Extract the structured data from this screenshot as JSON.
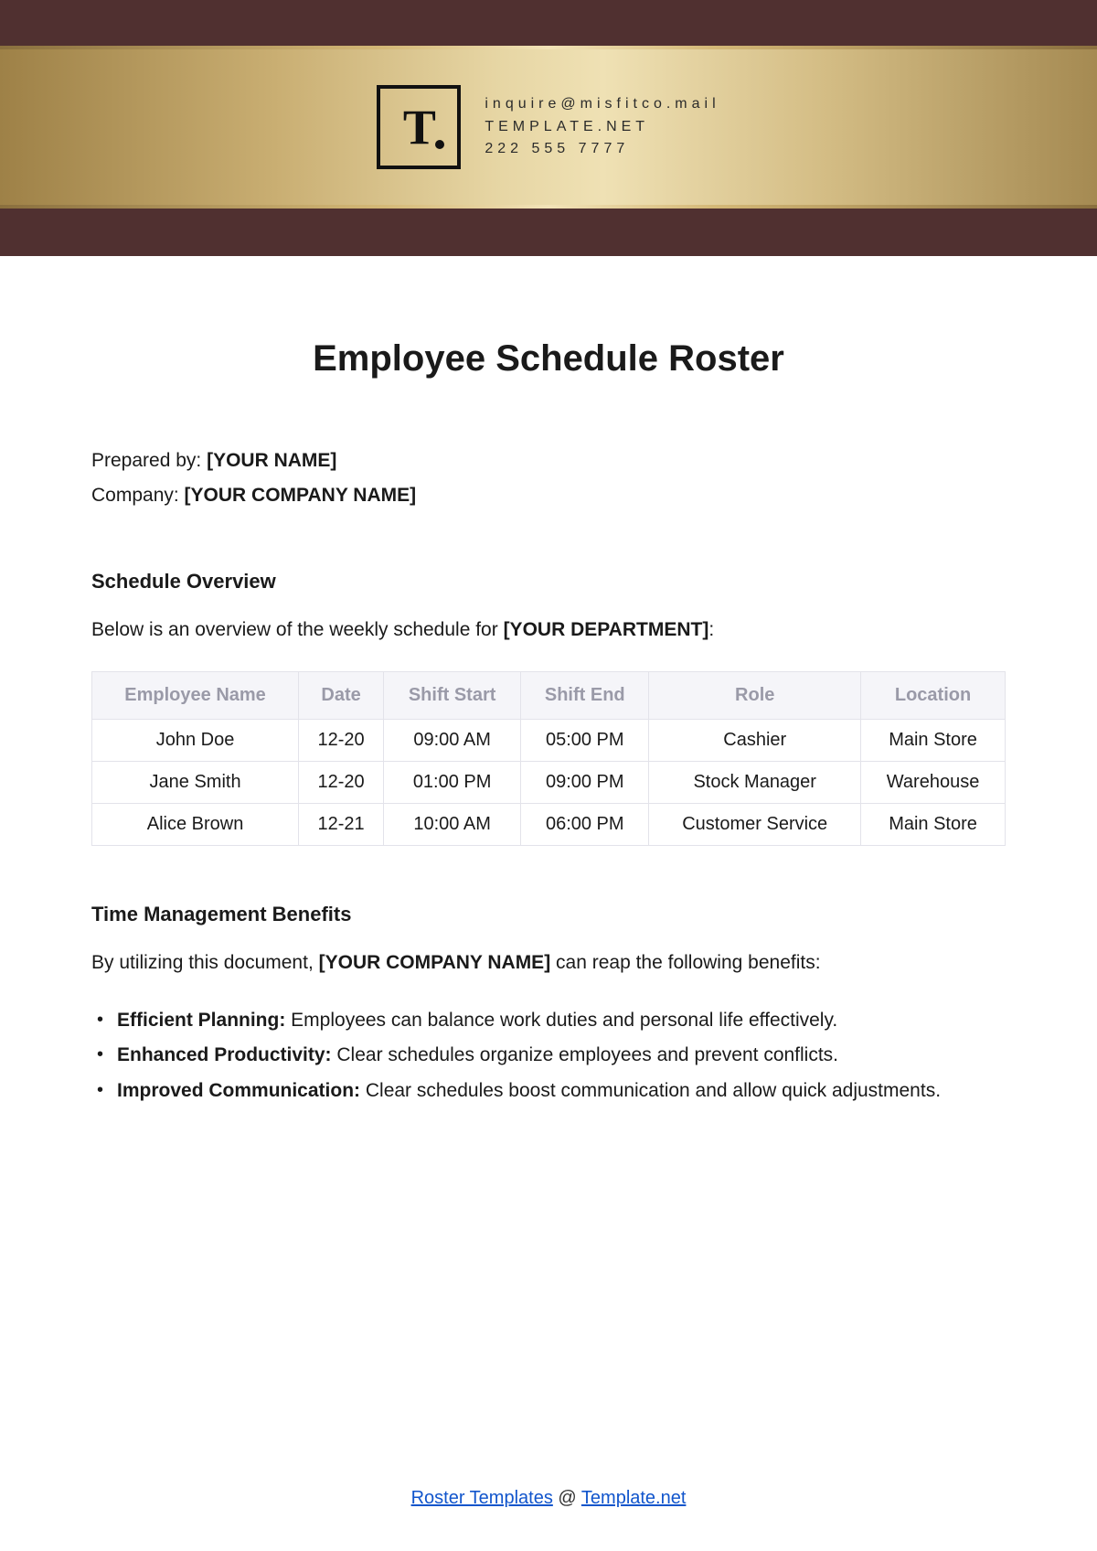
{
  "header": {
    "contact": {
      "email": "inquire@misfitco.mail",
      "site": "TEMPLATE.NET",
      "phone": "222 555 7777"
    },
    "logo_letter": "T"
  },
  "title": "Employee Schedule Roster",
  "meta": {
    "prepared_label": "Prepared by: ",
    "prepared_value": "[YOUR NAME]",
    "company_label": "Company: ",
    "company_value": "[YOUR COMPANY NAME]"
  },
  "overview": {
    "heading": "Schedule Overview",
    "intro_prefix": "Below is an overview of the weekly schedule for ",
    "intro_bold": "[YOUR DEPARTMENT]",
    "intro_suffix": ":"
  },
  "table": {
    "headers": [
      "Employee Name",
      "Date",
      "Shift Start",
      "Shift End",
      "Role",
      "Location"
    ],
    "rows": [
      [
        "John Doe",
        "12-20",
        "09:00 AM",
        "05:00 PM",
        "Cashier",
        "Main Store"
      ],
      [
        "Jane Smith",
        "12-20",
        "01:00 PM",
        "09:00 PM",
        "Stock Manager",
        "Warehouse"
      ],
      [
        "Alice Brown",
        "12-21",
        "10:00 AM",
        "06:00 PM",
        "Customer Service",
        "Main Store"
      ]
    ]
  },
  "benefits": {
    "heading": "Time Management Benefits",
    "intro_prefix": "By utilizing this document, ",
    "intro_bold": "[YOUR COMPANY NAME]",
    "intro_suffix": " can reap the following benefits:",
    "items": [
      {
        "label": "Efficient Planning:",
        "text": " Employees can balance work duties and personal life effectively."
      },
      {
        "label": "Enhanced Productivity:",
        "text": " Clear schedules organize employees and prevent conflicts."
      },
      {
        "label": "Improved Communication:",
        "text": " Clear schedules boost communication and allow quick adjustments."
      }
    ]
  },
  "footer": {
    "link1": "Roster Templates",
    "at": " @ ",
    "link2": "Template.net"
  }
}
